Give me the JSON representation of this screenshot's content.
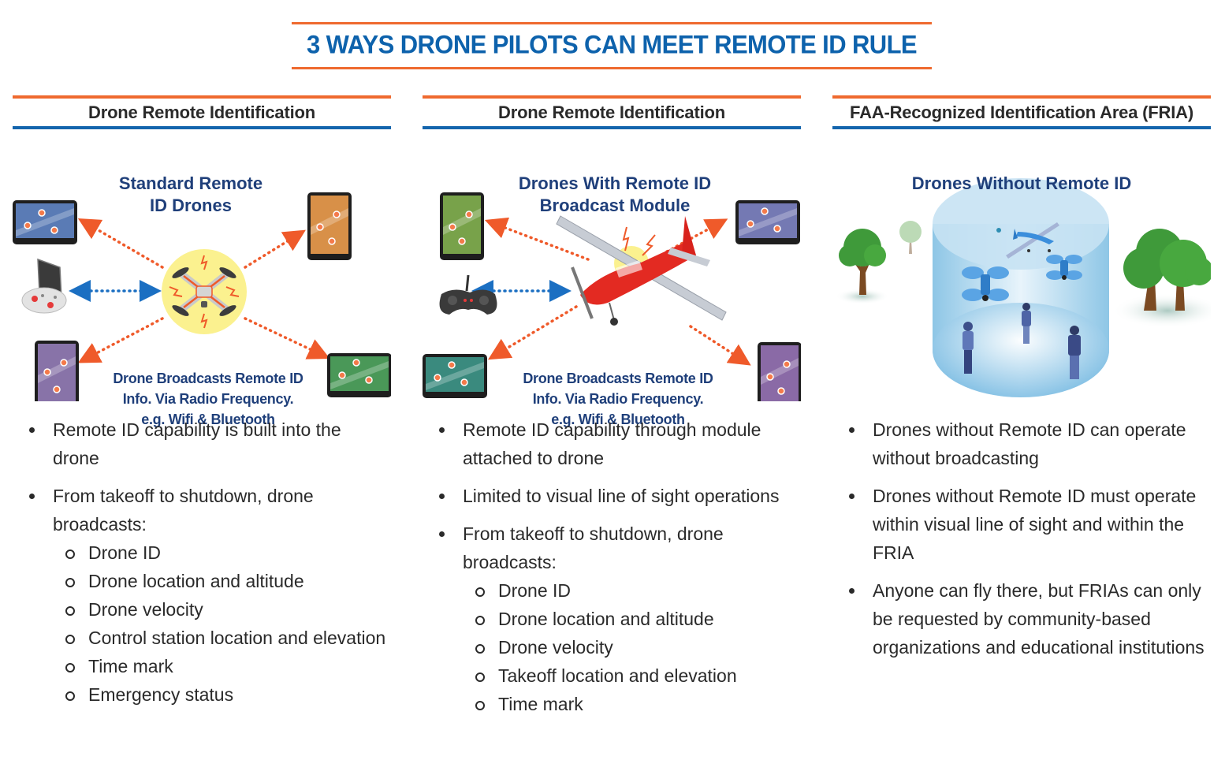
{
  "title": "3 WAYS DRONE PILOTS CAN MEET REMOTE ID RULE",
  "colors": {
    "accent_orange": "#ef6a2f",
    "accent_blue": "#1465ad",
    "title_blue": "#0d62ac",
    "figure_text_navy": "#1f3f7a"
  },
  "columns": [
    {
      "header": "Drone Remote Identification",
      "figure": {
        "title_line1": "Standard Remote",
        "title_line2": "ID Drones",
        "caption_line1": "Drone Broadcasts Remote ID",
        "caption_line2": "Info. Via Radio Frequency.",
        "caption_line3": "e.g. Wifi & Bluetooth",
        "icons": [
          "tablet-blue-icon",
          "tablet-orange-icon",
          "remote-controller-icon",
          "quadcopter-drone-icon",
          "tablet-purple-icon",
          "tablet-green-icon"
        ]
      },
      "bullets": [
        {
          "text": "Remote ID capability is built into the drone"
        },
        {
          "text": "From takeoff to shutdown, drone broadcasts:",
          "sub": [
            "Drone ID",
            "Drone location and altitude",
            "Drone velocity",
            "Control station location and elevation",
            "Time mark",
            "Emergency status"
          ]
        }
      ]
    },
    {
      "header": "Drone Remote Identification",
      "figure": {
        "title_line1": "Drones With Remote ID",
        "title_line2": "Broadcast Module",
        "caption_line1": "Drone Broadcasts Remote ID",
        "caption_line2": "Info. Via Radio Frequency.",
        "caption_line3": "e.g. Wifi & Bluetooth",
        "icons": [
          "tablet-green-icon",
          "tablet-lavender-icon",
          "gamepad-controller-icon",
          "airplane-drone-icon",
          "tablet-teal-icon",
          "tablet-purple-icon"
        ]
      },
      "bullets": [
        {
          "text": "Remote ID capability through module attached to drone"
        },
        {
          "text": "Limited to visual line of sight operations"
        },
        {
          "text": "From takeoff to shutdown, drone broadcasts:",
          "sub": [
            "Drone ID",
            "Drone location and altitude",
            "Drone velocity",
            "Takeoff location and elevation",
            "Time mark"
          ]
        }
      ]
    },
    {
      "header": "FAA-Recognized Identification Area (FRIA)",
      "figure": {
        "title_line1": "Drones Without Remote ID",
        "icons": [
          "tree-icon",
          "cylinder-area-icon",
          "airplane-icon",
          "quadcopter-icon",
          "pilot-person-icon"
        ]
      },
      "bullets": [
        {
          "text": "Drones without Remote ID can operate without broadcasting"
        },
        {
          "text": "Drones without Remote ID must operate within visual line of sight and within the FRIA"
        },
        {
          "text": "Anyone can fly there, but FRIAs can only be requested by community-based organizations and educational institutions"
        }
      ]
    }
  ]
}
